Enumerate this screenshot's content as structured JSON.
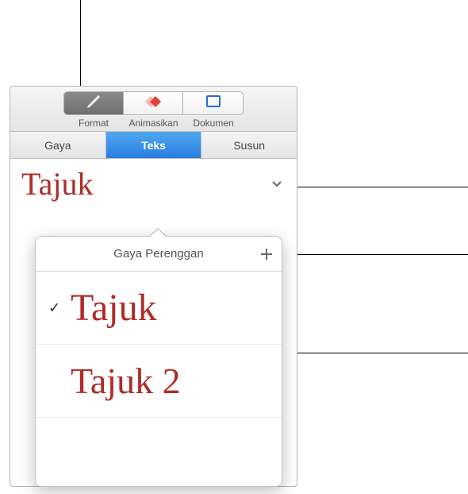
{
  "toolbar": {
    "segments": {
      "format": {
        "label": "Format"
      },
      "animate": {
        "label": "Animasikan"
      },
      "document": {
        "label": "Dokumen"
      }
    }
  },
  "tabs": {
    "style": {
      "label": "Gaya"
    },
    "text": {
      "label": "Teks"
    },
    "arrange": {
      "label": "Susun"
    }
  },
  "inspector": {
    "current_style": "Tajuk"
  },
  "popover": {
    "title": "Gaya Perenggan",
    "items": [
      {
        "label": "Tajuk",
        "selected": true,
        "size_class": "sz-title"
      },
      {
        "label": "Tajuk 2",
        "selected": false,
        "size_class": "sz-title2"
      }
    ]
  },
  "icons": {
    "format": "paintbrush",
    "animate": "diamond-red",
    "document": "rect-blue",
    "disclosure": "chevron-down",
    "add": "plus",
    "check": "✓"
  }
}
